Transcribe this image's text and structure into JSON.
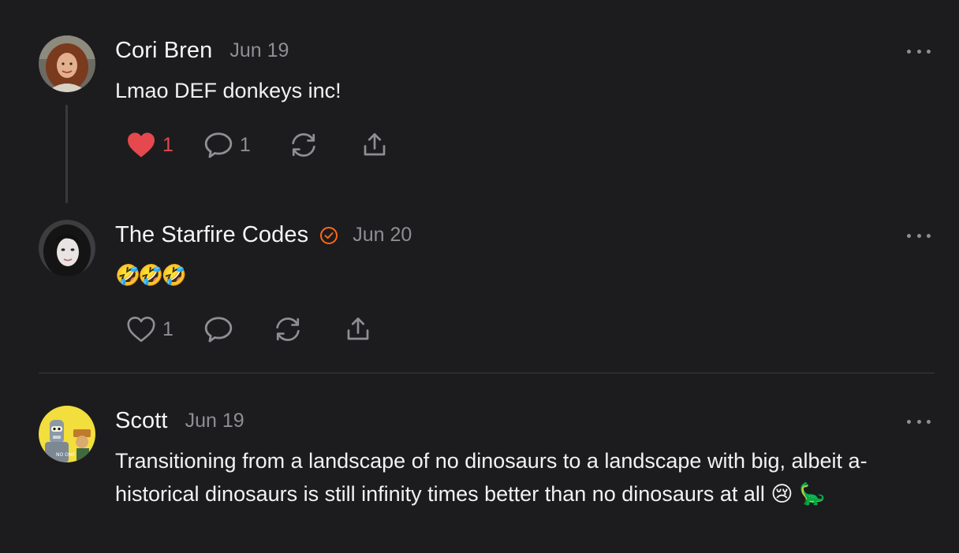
{
  "comments": [
    {
      "author": "Cori Bren",
      "date": "Jun 19",
      "text": "Lmao DEF donkeys inc!",
      "likes": "1",
      "replies": "1",
      "liked": true
    },
    {
      "author": "The Starfire Codes",
      "verified": true,
      "date": "Jun 20",
      "text": "🤣🤣🤣",
      "likes": "1",
      "replies": "",
      "liked": false
    },
    {
      "author": "Scott",
      "date": "Jun 19",
      "text": "Transitioning from a landscape of no dinosaurs to a landscape with big, albeit a-historical dinosaurs is still infinity times better than no dinosaurs at all 😢 🦕"
    }
  ],
  "icons": {
    "like": "heart-icon",
    "comment": "comment-bubble-icon",
    "restack": "restack-icon",
    "share": "share-icon",
    "more": "more-options-icon",
    "verified": "verified-badge-icon"
  },
  "colors": {
    "background": "#1c1c1e",
    "liked": "#e5484d",
    "verified": "#ff6719",
    "muted": "#8e8e93"
  }
}
